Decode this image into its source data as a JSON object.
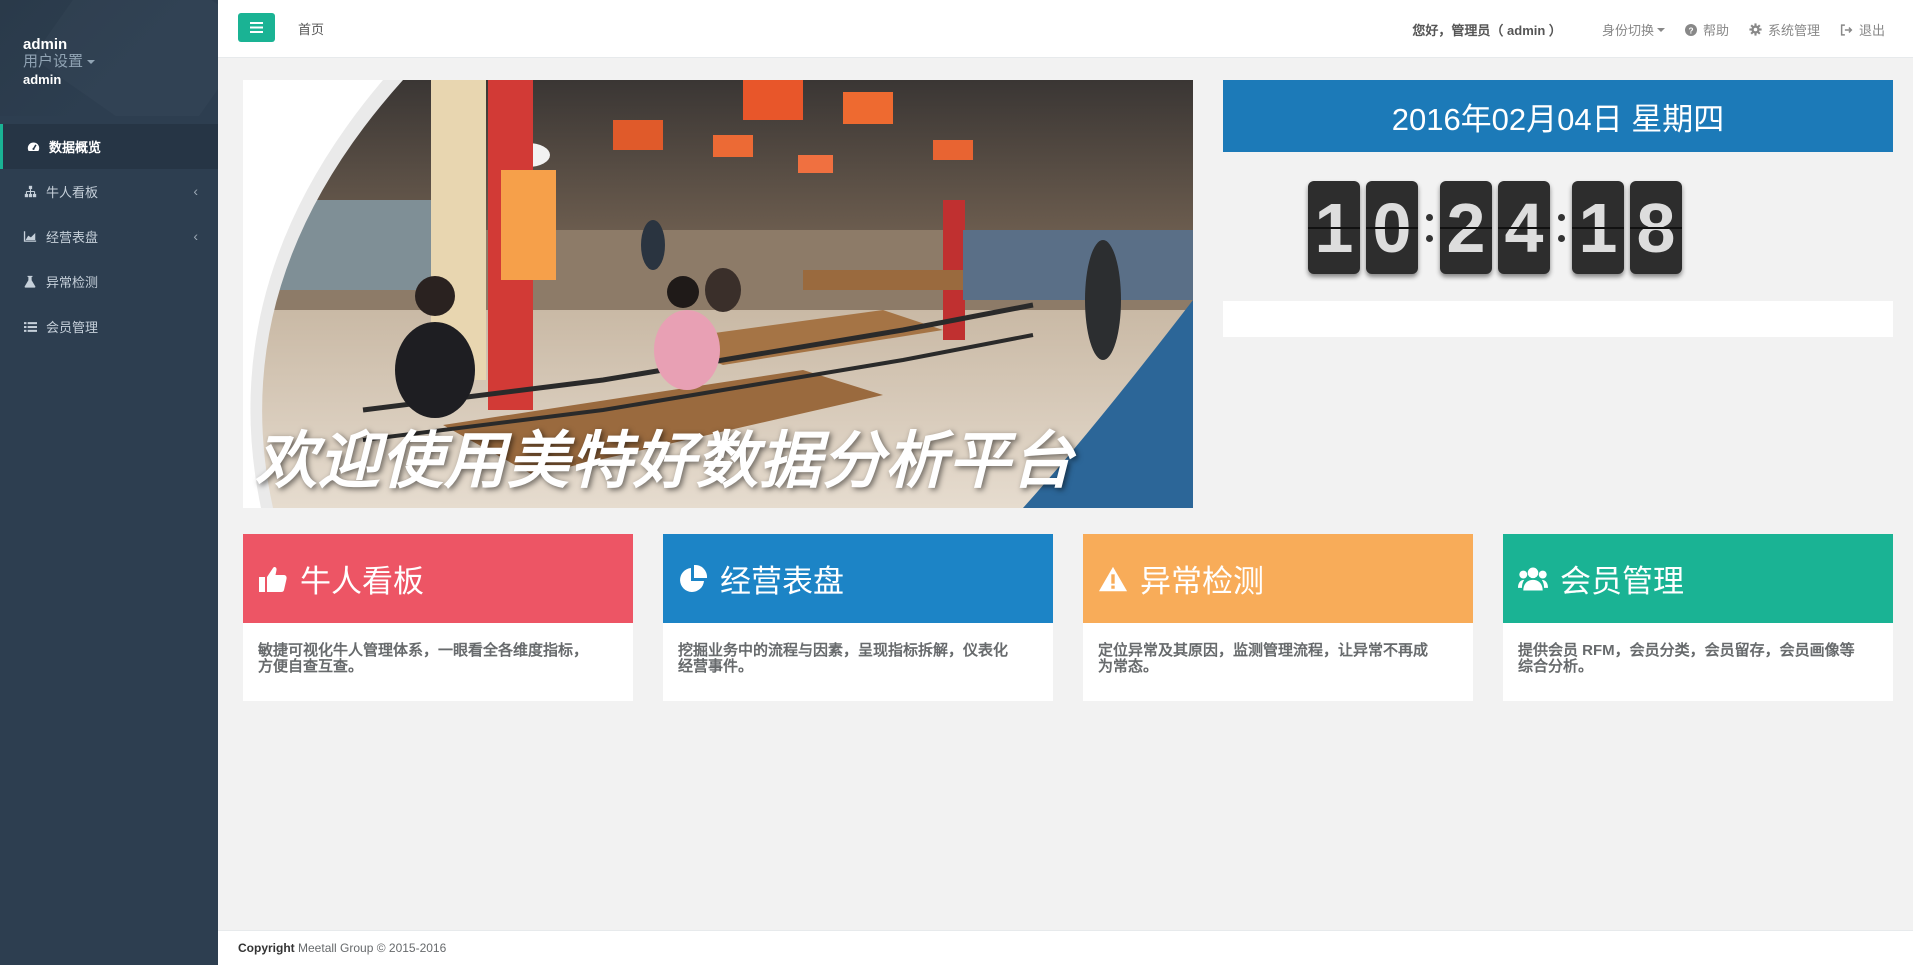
{
  "sidebar": {
    "profile": {
      "name": "admin",
      "settings_label": "用户设置",
      "role": "admin"
    },
    "items": [
      {
        "label": "数据概览",
        "icon": "dashboard-icon",
        "active": true
      },
      {
        "label": "牛人看板",
        "icon": "sitemap-icon",
        "has_children": true
      },
      {
        "label": "经营表盘",
        "icon": "area-chart-icon",
        "has_children": true
      },
      {
        "label": "异常检测",
        "icon": "flask-icon"
      },
      {
        "label": "会员管理",
        "icon": "list-icon"
      }
    ],
    "chevron": "‹"
  },
  "topbar": {
    "breadcrumb": "首页",
    "greeting": "您好，管理员（ admin ）",
    "role_switch": "身份切换",
    "help": "帮助",
    "system": "系统管理",
    "logout": "退出"
  },
  "banner": {
    "title": "欢迎使用美特好数据分析平台"
  },
  "clock": {
    "date": "2016年02月04日 星期四",
    "hours": [
      "1",
      "0"
    ],
    "minutes": [
      "2",
      "4"
    ],
    "seconds": [
      "1",
      "8"
    ]
  },
  "cards": [
    {
      "title": "牛人看板",
      "icon": "thumbs-up-icon",
      "color": "#ed5565",
      "desc_line1": "敏捷可视化牛人管理体系，一眼看全各维度指标，",
      "desc_line2": "方便自查互查。"
    },
    {
      "title": "经营表盘",
      "icon": "pie-chart-icon",
      "color": "#1c84c6",
      "desc_line1": "挖掘业务中的流程与因素，呈现指标拆解，仪表化",
      "desc_line2": "经营事件。"
    },
    {
      "title": "异常检测",
      "icon": "warning-icon",
      "color": "#f8ac59",
      "desc_line1": "定位异常及其原因，监测管理流程，让异常不再成",
      "desc_line2": "为常态。"
    },
    {
      "title": "会员管理",
      "icon": "users-icon",
      "color": "#1ab394",
      "desc_line1": "提供会员 RFM，会员分类，会员留存，会员画像等",
      "desc_line2": "综合分析。"
    }
  ],
  "footer": {
    "copyright_label": "Copyright",
    "text": "Meetall Group © 2015-2016"
  },
  "colors": {
    "sidebar_bg": "#2d3e50",
    "accent": "#1ab394",
    "date_bar": "#1c7ab8"
  }
}
